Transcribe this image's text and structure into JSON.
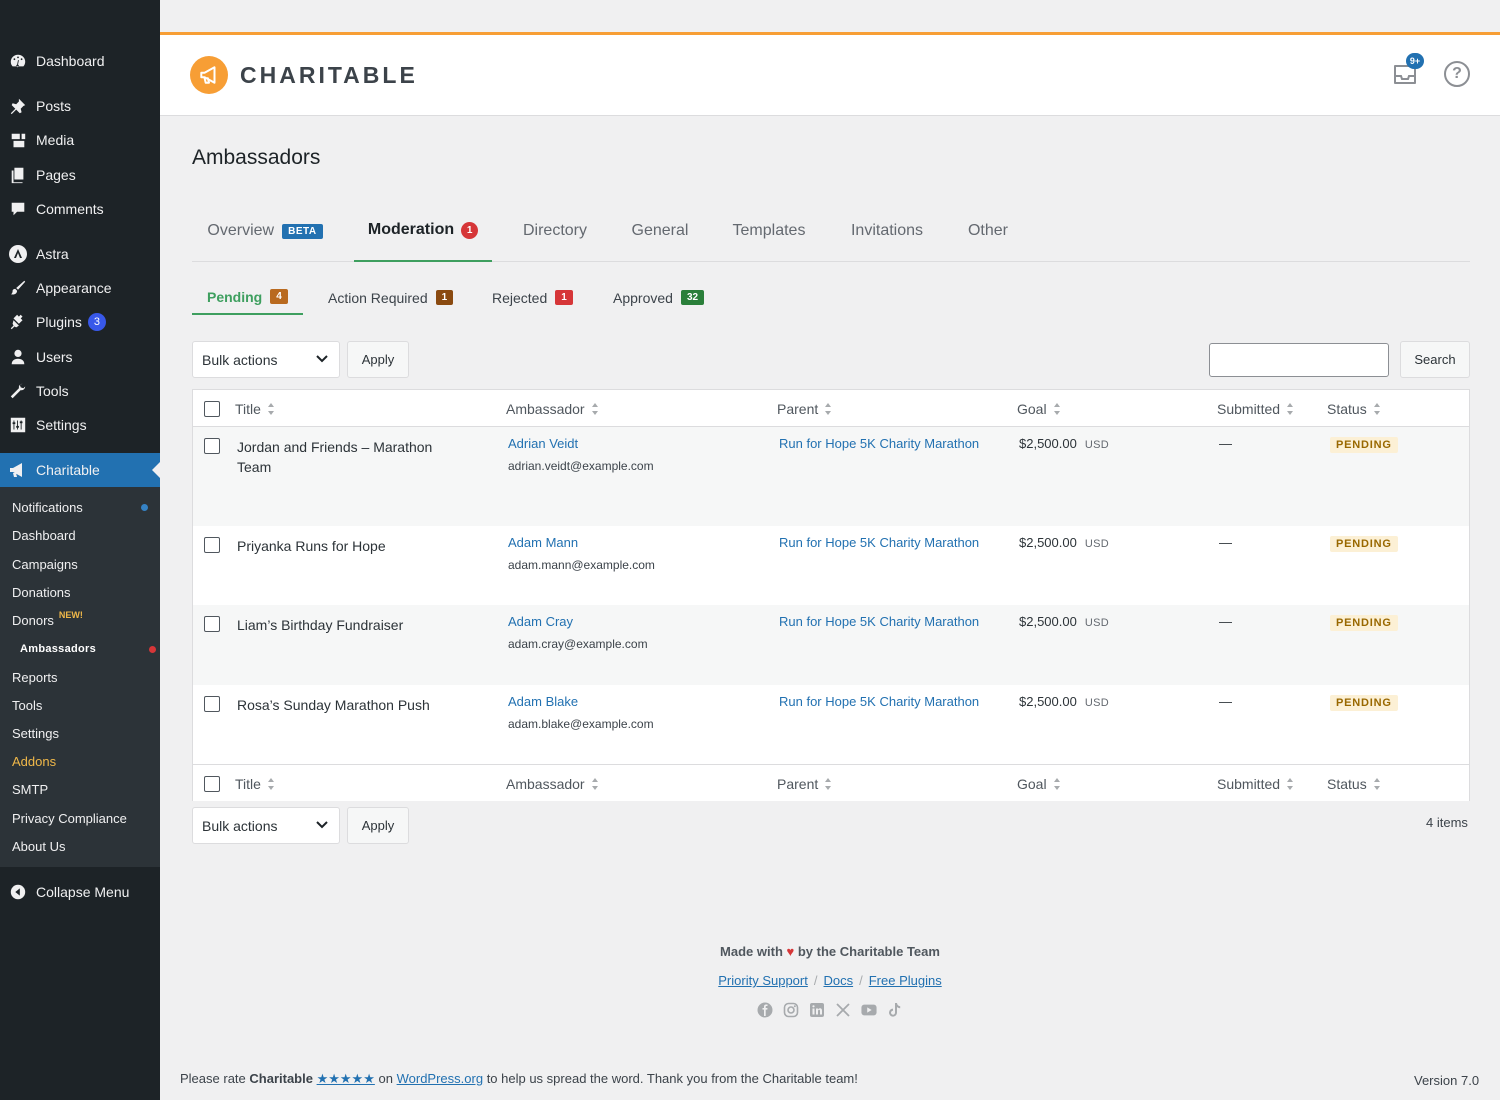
{
  "sidebar": {
    "menu": [
      {
        "label": "Dashboard",
        "icon": "dashboard-icon"
      },
      {
        "label": "Posts",
        "icon": "pin-icon"
      },
      {
        "label": "Media",
        "icon": "media-icon"
      },
      {
        "label": "Pages",
        "icon": "pages-icon"
      },
      {
        "label": "Comments",
        "icon": "comment-icon"
      },
      {
        "label": "Astra",
        "icon": "astra-icon"
      },
      {
        "label": "Appearance",
        "icon": "brush-icon"
      },
      {
        "label": "Plugins",
        "icon": "plug-icon",
        "count": "3"
      },
      {
        "label": "Users",
        "icon": "user-icon"
      },
      {
        "label": "Tools",
        "icon": "wrench-icon"
      },
      {
        "label": "Settings",
        "icon": "settings-icon"
      },
      {
        "label": "Charitable",
        "icon": "megaphone-icon"
      }
    ],
    "submenu": [
      "Notifications",
      "Dashboard",
      "Campaigns",
      "Donations",
      "Donors",
      "Ambassadors",
      "Reports",
      "Tools",
      "Settings",
      "Addons",
      "SMTP",
      "Privacy Compliance",
      "About Us"
    ],
    "donors_new": "NEW!",
    "collapse": "Collapse Menu"
  },
  "header": {
    "brand": "CHARITABLE",
    "inbox_badge": "9+",
    "help": "?"
  },
  "page_title": "Ambassadors",
  "tabs": {
    "overview": "Overview",
    "beta": "BETA",
    "moderation": "Moderation",
    "moderation_count": "1",
    "directory": "Directory",
    "general": "General",
    "templates": "Templates",
    "invitations": "Invitations",
    "other": "Other"
  },
  "subtabs": [
    {
      "label": "Pending",
      "count": "4",
      "color": "#b96a1f"
    },
    {
      "label": "Action Required",
      "count": "1",
      "color": "#8a4a10"
    },
    {
      "label": "Rejected",
      "count": "1",
      "color": "#d63638"
    },
    {
      "label": "Approved",
      "count": "32",
      "color": "#2a7f3a"
    }
  ],
  "controls": {
    "bulk": "Bulk actions",
    "apply": "Apply",
    "search_button": "Search",
    "search_value": ""
  },
  "columns": {
    "title": "Title",
    "ambassador": "Ambassador",
    "parent": "Parent",
    "goal": "Goal",
    "submitted": "Submitted",
    "status": "Status"
  },
  "rows": [
    {
      "title": "Jordan and Friends – Marathon Team",
      "ambassador": "Adrian Veidt",
      "email": "adrian.veidt@example.com",
      "parent": "Run for Hope 5K Charity Marathon",
      "goal": "$2,500.00",
      "currency": "USD",
      "submitted": "—",
      "status": "PENDING"
    },
    {
      "title": "Priyanka Runs for Hope",
      "ambassador": "Adam Mann",
      "email": "adam.mann@example.com",
      "parent": "Run for Hope 5K Charity Marathon",
      "goal": "$2,500.00",
      "currency": "USD",
      "submitted": "—",
      "status": "PENDING"
    },
    {
      "title": "Liam’s Birthday Fundraiser",
      "ambassador": "Adam Cray",
      "email": "adam.cray@example.com",
      "parent": "Run for Hope 5K Charity Marathon",
      "goal": "$2,500.00",
      "currency": "USD",
      "submitted": "—",
      "status": "PENDING"
    },
    {
      "title": "Rosa’s Sunday Marathon Push",
      "ambassador": "Adam Blake",
      "email": "adam.blake@example.com",
      "parent": "Run for Hope 5K Charity Marathon",
      "goal": "$2,500.00",
      "currency": "USD",
      "submitted": "—",
      "status": "PENDING"
    }
  ],
  "items_count": "4 items",
  "footer": {
    "made_with": "Made with",
    "by_team": "by the Charitable Team",
    "links": [
      "Priority Support",
      "Docs",
      "Free Plugins"
    ],
    "sep": "/",
    "socials": [
      "facebook-icon",
      "instagram-icon",
      "linkedin-icon",
      "x-icon",
      "youtube-icon",
      "tiktok-icon"
    ]
  },
  "bottom": {
    "please_rate": "Please rate",
    "brand": "Charitable",
    "stars": "★★★★★",
    "on": "on",
    "wporg": "WordPress.org",
    "rest": "to help us spread the word. Thank you from the Charitable team!",
    "version": "Version 7.0"
  },
  "colors": {
    "accent": "#f79e35",
    "wp_blue": "#2271b1",
    "green": "#3e9f5f",
    "red": "#d63638"
  }
}
